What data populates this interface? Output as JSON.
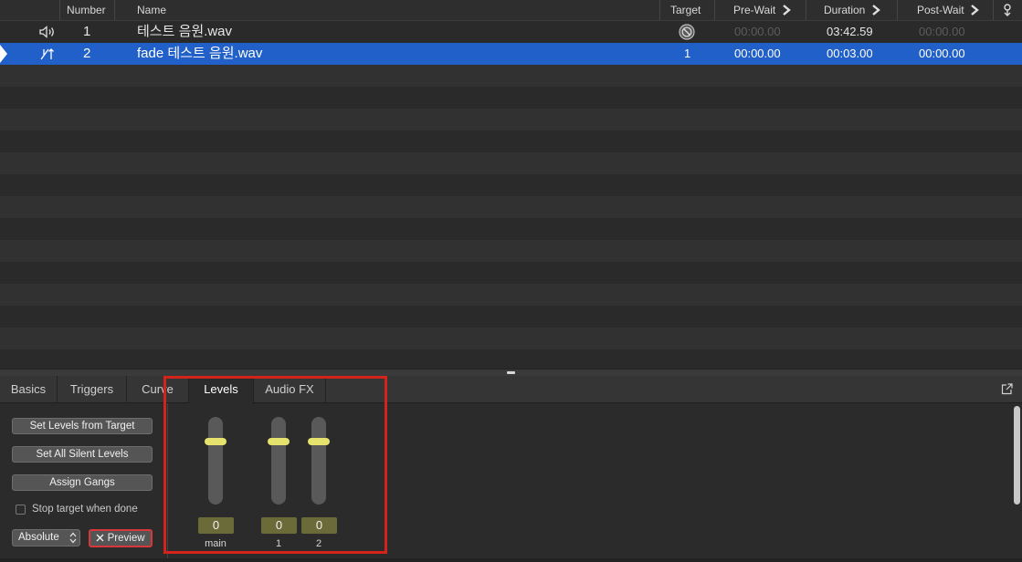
{
  "cue_list": {
    "columns": {
      "number": "Number",
      "name": "Name",
      "target": "Target",
      "pre_wait": "Pre-Wait",
      "duration": "Duration",
      "post_wait": "Post-Wait"
    },
    "rows": [
      {
        "type_icon": "speaker-icon",
        "number": "1",
        "name": "테스트 음원.wav",
        "target_icon": "target-ok-icon",
        "pre_wait": "00:00.00",
        "duration": "03:42.59",
        "post_wait": "00:00.00",
        "selected": false
      },
      {
        "type_icon": "fade-icon",
        "number": "2",
        "name": "fade 테스트 음원.wav",
        "target": "1",
        "pre_wait": "00:00.00",
        "duration": "00:03.00",
        "post_wait": "00:00.00",
        "selected": true
      }
    ]
  },
  "inspector": {
    "tabs": [
      "Basics",
      "Triggers",
      "Curve",
      "Levels",
      "Audio FX"
    ],
    "active_tab": "Levels",
    "buttons": {
      "set_levels_from_target": "Set Levels from Target",
      "set_all_silent_levels": "Set All Silent Levels",
      "assign_gangs": "Assign Gangs"
    },
    "stop_target_label": "Stop target when done",
    "stop_target_checked": false,
    "mode_select": "Absolute",
    "preview_label": "Preview",
    "faders": [
      {
        "label": "main",
        "value": "0"
      },
      {
        "label": "1",
        "value": "0"
      },
      {
        "label": "2",
        "value": "0"
      }
    ]
  },
  "colors": {
    "selection": "#2160c8",
    "fader_thumb": "#e5e36e",
    "level_box": "#6b6b3a",
    "highlight": "#d4231a"
  }
}
